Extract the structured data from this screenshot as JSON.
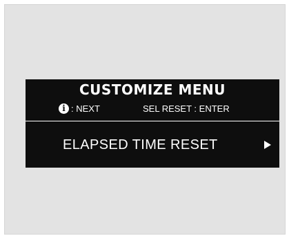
{
  "display": {
    "title": "CUSTOMIZE MENU",
    "info_hint_label": ": NEXT",
    "sel_hint_label": "SEL RESET : ENTER",
    "menu_item_label": "ELAPSED TIME RESET",
    "info_icon_glyph": "i"
  },
  "icons": {
    "info": "info-icon",
    "arrow": "right-arrow-icon"
  },
  "colors": {
    "panel_background": "#e3e3e3",
    "display_background": "#0e0e0e",
    "display_text": "#ffffff"
  }
}
